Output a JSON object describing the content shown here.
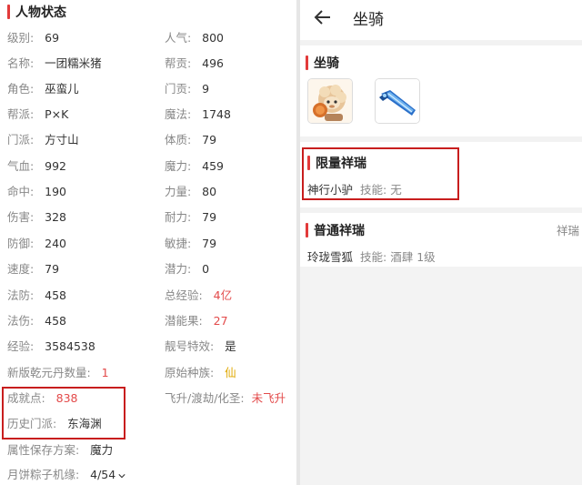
{
  "left": {
    "title": "人物状态",
    "stats": [
      {
        "label": "级别:",
        "value": "69"
      },
      {
        "label": "人气:",
        "value": "800"
      },
      {
        "label": "名称:",
        "value": "一团糯米猪"
      },
      {
        "label": "帮贡:",
        "value": "496"
      },
      {
        "label": "角色:",
        "value": "巫蛮儿"
      },
      {
        "label": "门贡:",
        "value": "9"
      },
      {
        "label": "帮派:",
        "value": "P×K"
      },
      {
        "label": "魔法:",
        "value": "1748"
      },
      {
        "label": "门派:",
        "value": "方寸山"
      },
      {
        "label": "体质:",
        "value": "79"
      },
      {
        "label": "气血:",
        "value": "992"
      },
      {
        "label": "魔力:",
        "value": "459"
      },
      {
        "label": "命中:",
        "value": "190"
      },
      {
        "label": "力量:",
        "value": "80"
      },
      {
        "label": "伤害:",
        "value": "328"
      },
      {
        "label": "耐力:",
        "value": "79"
      },
      {
        "label": "防御:",
        "value": "240"
      },
      {
        "label": "敏捷:",
        "value": "79"
      },
      {
        "label": "速度:",
        "value": "79"
      },
      {
        "label": "潜力:",
        "value": "0"
      },
      {
        "label": "法防:",
        "value": "458"
      },
      {
        "label": "总经验:",
        "value": "4亿"
      },
      {
        "label": "法伤:",
        "value": "458"
      },
      {
        "label": "潜能果:",
        "value": "27"
      },
      {
        "label": "经验:",
        "value": "3584538"
      },
      {
        "label": "靓号特效:",
        "value": "是"
      },
      {
        "label": "新版乾元丹数量:",
        "value": "1"
      },
      {
        "label": "原始种族:",
        "value": "仙"
      },
      {
        "label": "成就点:",
        "value": "838"
      },
      {
        "label": "飞升/渡劫/化圣:",
        "value": "未飞升"
      },
      {
        "label": "历史门派:",
        "value": "东海渊"
      },
      {
        "label": "属性保存方案:",
        "value": "魔力"
      },
      {
        "label": "月饼粽子机缘:",
        "value": "4/54"
      }
    ]
  },
  "right": {
    "title": "坐骑",
    "mounts_section_title": "坐骑",
    "mount_icons": [
      "sheep-mount-icon",
      "blue-sword-mount-icon"
    ],
    "limited": {
      "title": "限量祥瑞",
      "items": [
        {
          "name": "神行小驴",
          "skill_label": "技能:",
          "skill_value": "无"
        }
      ]
    },
    "normal": {
      "title": "普通祥瑞",
      "items": [
        {
          "name": "玲珑雪狐",
          "skill_label": "技能:",
          "skill_value": "酒肆 1级"
        }
      ],
      "right_text": "祥瑞"
    }
  },
  "colors": {
    "accent": "#e23a3a",
    "highlight_box": "#c81e1e",
    "value_red": "#e34a4a",
    "value_gold": "#e0a800"
  }
}
